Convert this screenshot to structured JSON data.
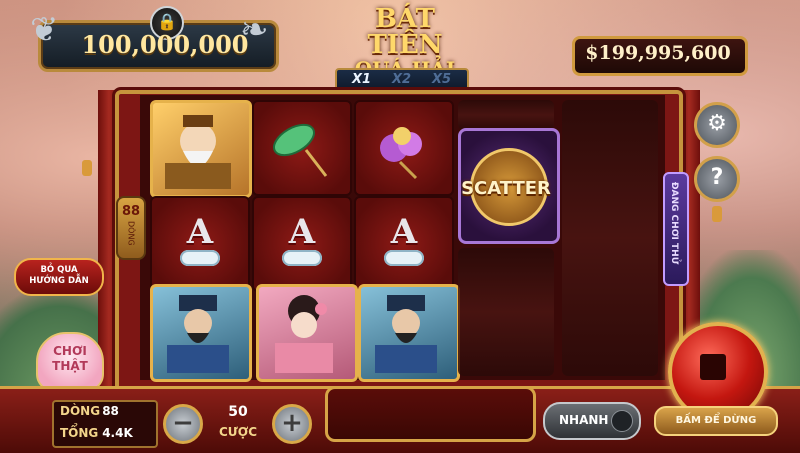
{
  "header": {
    "jackpot": "100,000,000",
    "logo_line1": "BÁT TIÊN",
    "logo_line2": "QUÁ HẢI",
    "balance": "$199,995,600",
    "multipliers": [
      "X1",
      "X2",
      "X5"
    ]
  },
  "reels": {
    "lines_tag": {
      "number": "88",
      "label": "DÒNG"
    },
    "playing_tag": "ĐANG CHƠI THỬ",
    "scatter_label": "SCATTER",
    "letter_symbol": "A"
  },
  "left_panel": {
    "skip_tutorial_line1": "BỎ QUA",
    "skip_tutorial_line2": "HƯỚNG DẪN",
    "play_real_line1": "CHƠI",
    "play_real_line2": "THẬT"
  },
  "bottom": {
    "lines_label": "DÒNG",
    "lines_value": "88",
    "total_label": "TỔNG",
    "total_value": "4.4K",
    "bet_value": "50",
    "bet_label": "CƯỢC",
    "fast_label": "NHANH",
    "stop_label": "BẤM ĐỂ DỪNG"
  },
  "icons": {
    "settings": "gear-icon",
    "help": "question-icon",
    "lock": "lock-icon"
  },
  "colors": {
    "gold": "#d6a447",
    "frame_red": "#7d1614",
    "scatter_purple": "#a877d6"
  }
}
